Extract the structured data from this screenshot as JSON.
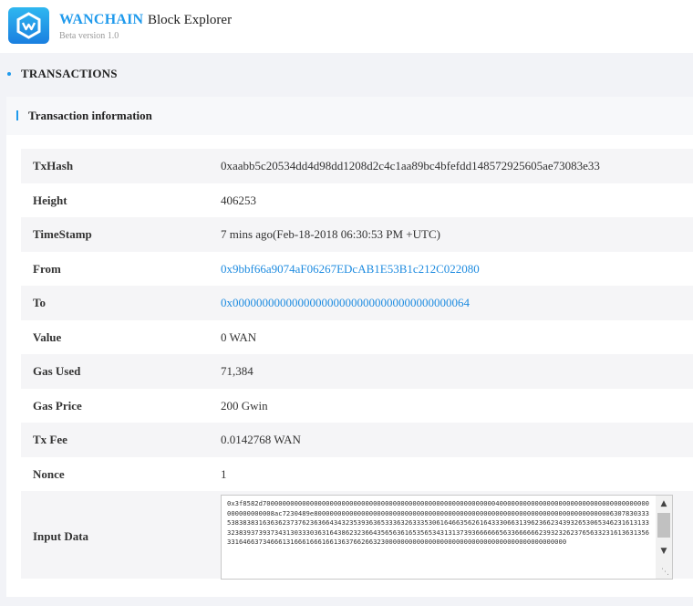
{
  "header": {
    "brand": "WANCHAIN",
    "subtitle": "Block Explorer",
    "version": "Beta version 1.0",
    "logo_icon": "wanchain-logo-icon"
  },
  "section": {
    "title": "TRANSACTIONS"
  },
  "card": {
    "title": "Transaction information"
  },
  "fields": [
    {
      "label": "TxHash",
      "value": "0xaabb5c20534dd4d98dd1208d2c4c1aa89bc4bfefdd148572925605ae73083e33"
    },
    {
      "label": "Height",
      "value": "406253"
    },
    {
      "label": "TimeStamp",
      "value": "7 mins ago(Feb-18-2018 06:30:53 PM +UTC)"
    },
    {
      "label": "From",
      "value": "0x9bbf66a9074aF06267EDcAB1E53B1c212C022080"
    },
    {
      "label": "To",
      "value": "0x0000000000000000000000000000000000000064"
    },
    {
      "label": "Value",
      "value": "0 WAN"
    },
    {
      "label": "Gas Used",
      "value": "71,384"
    },
    {
      "label": "Gas Price",
      "value": "200 Gwin"
    },
    {
      "label": "Tx Fee",
      "value": "0.0142768 WAN"
    },
    {
      "label": "Nonce",
      "value": "1"
    }
  ],
  "input_data": {
    "label": "Input Data",
    "value": "0x3f8582d70000000000000000000000000000000000000000000000000000000000400000000000000000000000000000000000000000000000008ac7230489e8000000000000000000000000000000000000000000000000000000000000000000000000006307830333538383831636362373762363664343235393636533363263335306164663562616433306631396236623439326530653462316131333238393739373431303330363164386232366435656361653565343131373936666665633666666239323262376563323161363135633164663734666131666166616613637662663230000000000000000000000000000000000000000000000"
  },
  "colors": {
    "accent": "#1f9aec",
    "link": "#1f8ce0"
  }
}
